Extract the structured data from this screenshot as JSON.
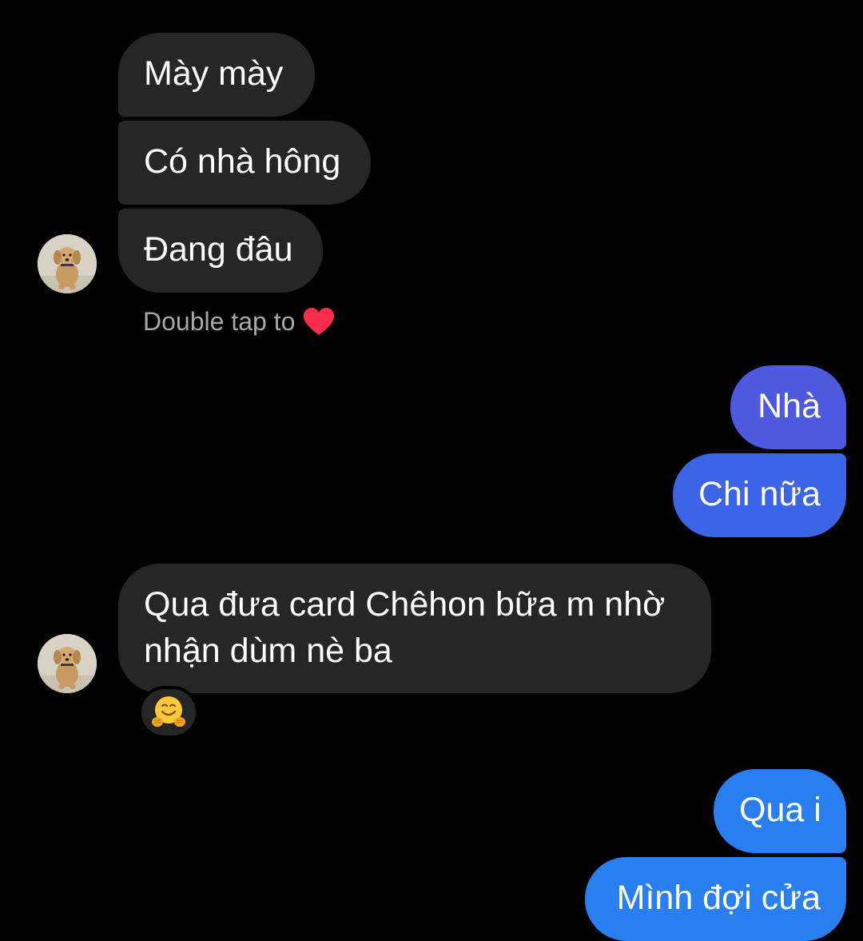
{
  "conversation": {
    "received_group_1": [
      "Mày mày",
      "Có nhà hông",
      "Đang đâu"
    ],
    "like_hint": "Double tap to",
    "sent_group_1": [
      "Nhà",
      "Chi nữa"
    ],
    "received_group_2": [
      "Qua đưa card Chêhon bữa m nhờ",
      "nhận dùm nè ba"
    ],
    "reaction_icon": "hugging-face-emoji",
    "sent_group_2": [
      "Qua i",
      "Mình đợi cửa"
    ]
  },
  "colors": {
    "background": "#000000",
    "received_bubble": "#262626",
    "sent_purple": "#4d5ae0",
    "sent_blue_mid": "#3b64e6",
    "sent_blue": "#2a7ff0",
    "hint_text": "#a8a8a8",
    "heart": "#ff2d4b"
  },
  "icons": {
    "avatar": "puppy-avatar",
    "hint_heart": "red-heart-icon",
    "reaction": "hugging-face-emoji"
  }
}
